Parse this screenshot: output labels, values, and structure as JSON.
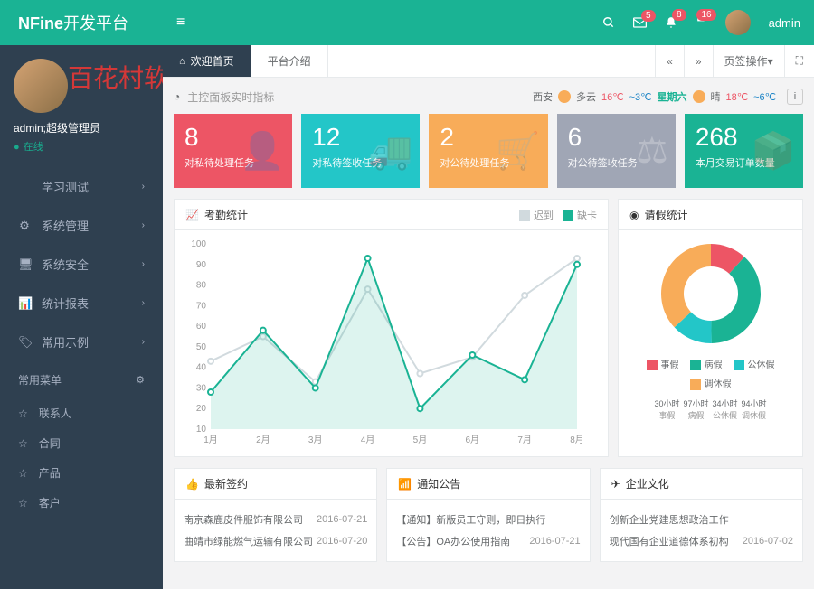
{
  "header": {
    "logoBold": "NFine",
    "logoText": "开发平台",
    "badges": {
      "mail": "5",
      "bell": "8",
      "flag": "16"
    },
    "userName": "admin"
  },
  "sidebar": {
    "profileName": "admin;超级管理员",
    "status": "在线",
    "nav": [
      {
        "icon": "",
        "label": "学习测试"
      },
      {
        "icon": "⚙",
        "label": "系统管理"
      },
      {
        "icon": "🖥",
        "label": "系统安全"
      },
      {
        "icon": "📊",
        "label": "统计报表"
      },
      {
        "icon": "🏷",
        "label": "常用示例"
      }
    ],
    "subHeader": "常用菜单",
    "subs": [
      {
        "label": "联系人"
      },
      {
        "label": "合同"
      },
      {
        "label": "产品"
      },
      {
        "label": "客户"
      }
    ]
  },
  "tabs": {
    "home": "欢迎首页",
    "t2": "平台介绍",
    "ops": "页签操作"
  },
  "breadcrumb": {
    "text": "主控面板实时指标",
    "city": "西安",
    "w1": "多云",
    "t1hi": "16℃",
    "t1lo": "~3℃",
    "day": "星期六",
    "w2": "晴",
    "t2hi": "18℃",
    "t2lo": "~6℃"
  },
  "watermark": "百花村软件园",
  "cards": [
    {
      "num": "8",
      "label": "对私待处理任务"
    },
    {
      "num": "12",
      "label": "对私待签收任务"
    },
    {
      "num": "2",
      "label": "对公待处理任务"
    },
    {
      "num": "6",
      "label": "对公待签收任务"
    },
    {
      "num": "268",
      "label": "本月交易订单数量"
    }
  ],
  "chart_data": [
    {
      "type": "line",
      "title": "考勤统计",
      "categories": [
        "1月",
        "2月",
        "3月",
        "4月",
        "5月",
        "6月",
        "7月",
        "8月"
      ],
      "series": [
        {
          "name": "迟到",
          "color": "#d1dade",
          "values": [
            43,
            55,
            33,
            78,
            37,
            45,
            75,
            93
          ]
        },
        {
          "name": "缺卡",
          "color": "#1ab394",
          "values": [
            28,
            58,
            30,
            93,
            20,
            46,
            34,
            90
          ]
        }
      ],
      "ylim": [
        10,
        100
      ],
      "yticks": [
        10,
        20,
        30,
        40,
        50,
        60,
        70,
        80,
        90,
        100
      ]
    },
    {
      "type": "pie",
      "title": "请假统计",
      "series": [
        {
          "name": "事假",
          "value": 30,
          "hours": "30小时",
          "color": "#ed5565"
        },
        {
          "name": "病假",
          "value": 97,
          "hours": "97小时",
          "color": "#1ab394"
        },
        {
          "name": "公休假",
          "value": 34,
          "hours": "34小时",
          "color": "#23c6c8"
        },
        {
          "name": "调休假",
          "value": 94,
          "hours": "94小时",
          "color": "#f8ac59"
        }
      ]
    }
  ],
  "panels": {
    "attendance": "考勤统计",
    "leave": "请假统计",
    "signing": "最新签约",
    "notice": "通知公告",
    "culture": "企业文化"
  },
  "signing": [
    {
      "name": "南京森鹿皮件服饰有限公司",
      "date": "2016-07-21"
    },
    {
      "name": "曲靖市绿能燃气运输有限公司",
      "date": "2016-07-20"
    }
  ],
  "notices": [
    {
      "name": "【通知】新版员工守则，即日执行",
      "date": ""
    },
    {
      "name": "【公告】OA办公使用指南",
      "date": "2016-07-21"
    }
  ],
  "culture": [
    {
      "name": "创新企业党建思想政治工作",
      "date": ""
    },
    {
      "name": "现代国有企业道德体系初构",
      "date": "2016-07-02"
    }
  ]
}
